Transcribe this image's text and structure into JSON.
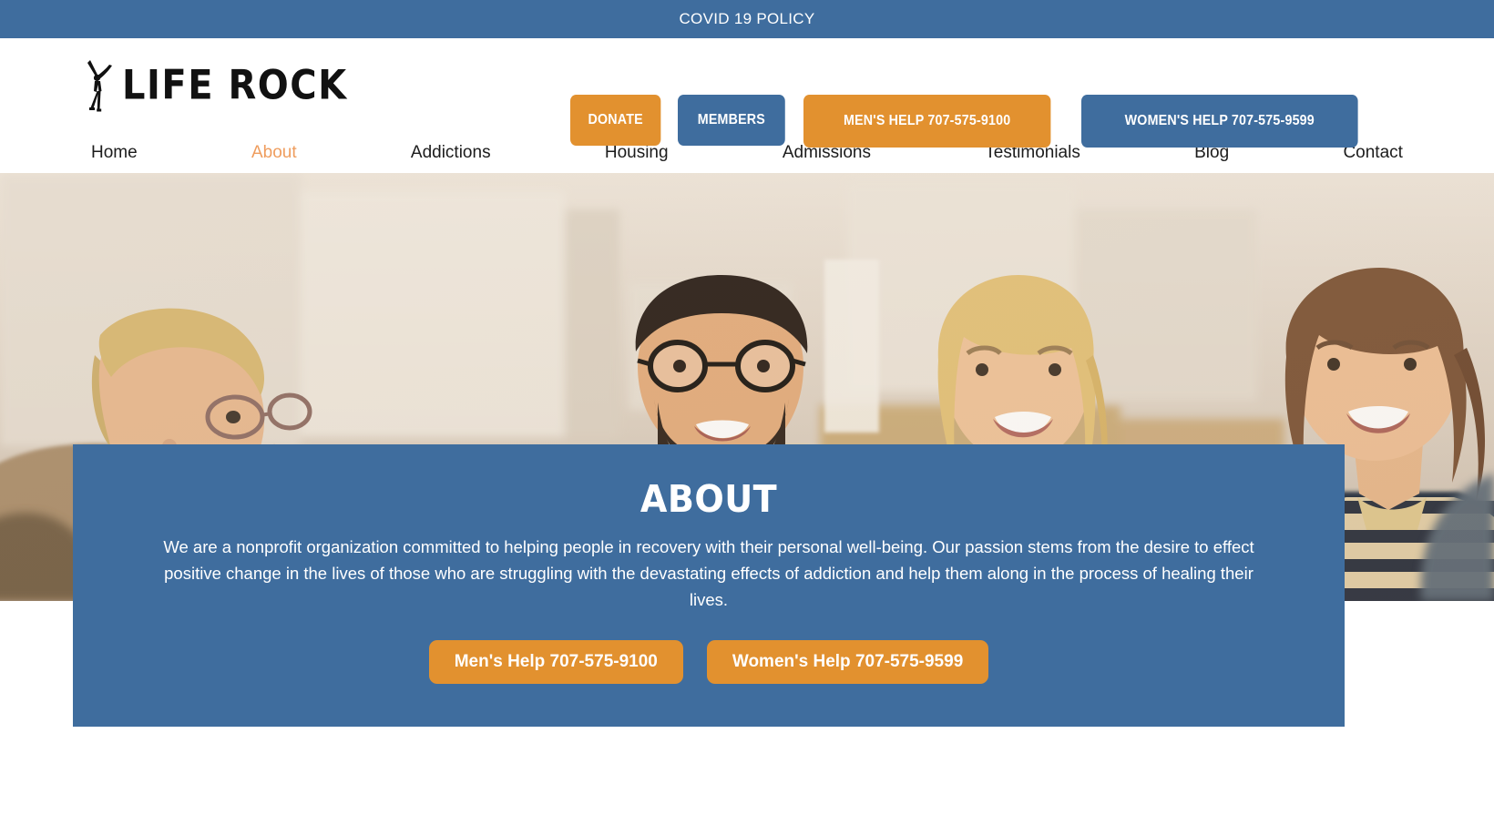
{
  "colors": {
    "brand_blue": "#3f6d9e",
    "brand_orange": "#e2912f",
    "nav_active": "#ef9d5e",
    "text_dark": "#1c1c1c",
    "white": "#ffffff"
  },
  "covid_bar": {
    "label": "COVID 19 POLICY"
  },
  "header": {
    "logo": {
      "text": "LIFE ROCK",
      "mark": "jumping-person-icon"
    },
    "buttons": [
      {
        "label": "DONATE",
        "style": "orange",
        "key": "donate"
      },
      {
        "label": "MEMBERS",
        "style": "blue",
        "key": "members"
      },
      {
        "label": "MEN'S HELP 707-575-9100",
        "style": "orange",
        "key": "menshelp"
      },
      {
        "label": "WOMEN'S HELP 707-575-9599",
        "style": "blue",
        "key": "womenshelp"
      }
    ]
  },
  "nav": {
    "active": "About",
    "items": [
      {
        "label": "Home"
      },
      {
        "label": "About"
      },
      {
        "label": "Addictions"
      },
      {
        "label": "Housing"
      },
      {
        "label": "Admissions"
      },
      {
        "label": "Testimonials"
      },
      {
        "label": "Blog"
      },
      {
        "label": "Contact"
      }
    ]
  },
  "hero": {
    "alt": "Group of people smiling during a support meeting in a bright room"
  },
  "about": {
    "title": "ABOUT",
    "body": "We are a nonprofit organization committed to helping people in recovery with their personal well-being. Our passion stems from the desire to effect positive change in the lives of those who are struggling with the devastating effects of addiction and help them along in the process of healing their lives.",
    "cta": [
      {
        "label": "Men's Help 707-575-9100"
      },
      {
        "label": "Women's Help 707-575-9599"
      }
    ]
  }
}
